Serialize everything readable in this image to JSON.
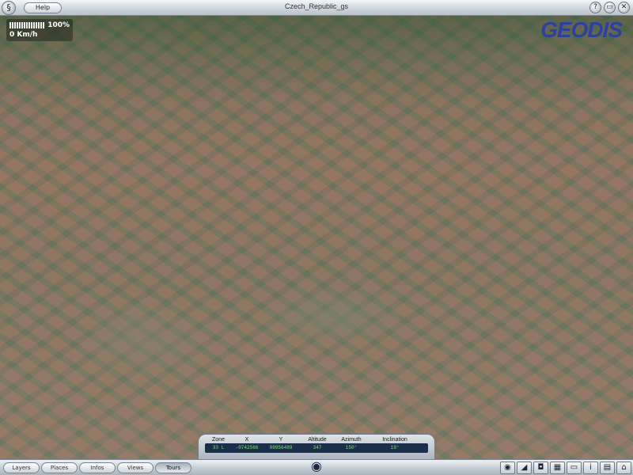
{
  "titlebar": {
    "title": "Czech_Republic_gs",
    "help_label": "Help",
    "logo_icon": "geodis-swirl-icon",
    "buttons": [
      "help-circle-icon",
      "minimize-icon",
      "close-icon"
    ]
  },
  "hud": {
    "speed_percent": "100%",
    "speed_value": "0 Km/h"
  },
  "brand": "GEODIS",
  "coords": {
    "headers": [
      "Zone",
      "X",
      "Y",
      "Altitude",
      "Azimuth",
      "Inclination"
    ],
    "values": [
      "33 L",
      "-0742566",
      "08956489",
      "347",
      "150°",
      "19°"
    ]
  },
  "bottom_tabs": [
    {
      "label": "Layers",
      "active": false
    },
    {
      "label": "Places",
      "active": false
    },
    {
      "label": "Infos",
      "active": false
    },
    {
      "label": "Views",
      "active": false
    },
    {
      "label": "Tours",
      "active": true
    }
  ],
  "tools": [
    "target-icon",
    "ruler-icon",
    "camera-icon",
    "map-icon",
    "monitor-icon",
    "info-icon",
    "grid-icon",
    "home-icon"
  ],
  "colors": {
    "brand": "#2d3fa0",
    "readout_text": "#7fe37a",
    "readout_bg": "#1c2f4a"
  }
}
